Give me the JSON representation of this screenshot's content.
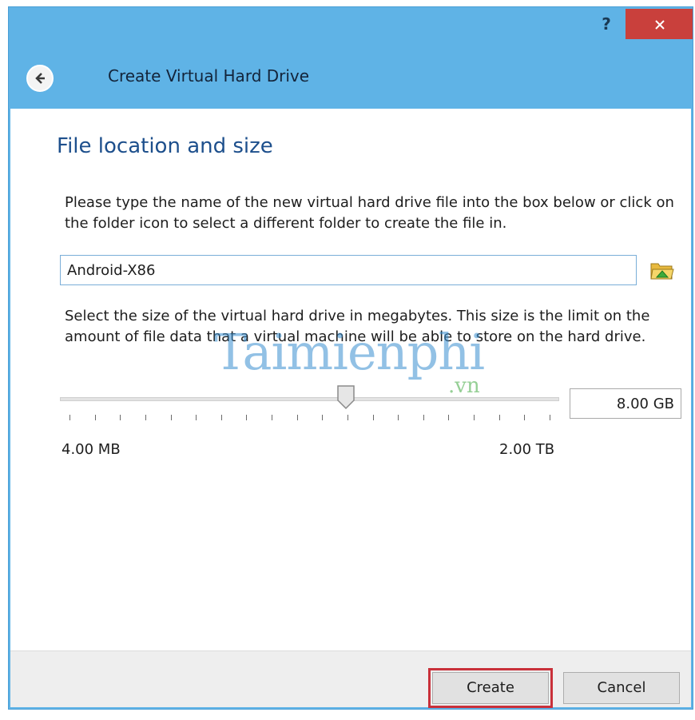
{
  "titlebar": {
    "help_label": "?"
  },
  "header": {
    "title": "Create Virtual Hard Drive"
  },
  "main": {
    "section_title": "File location and size",
    "instructions_location": "Please type the name of the new virtual hard drive file into the box below or click on the folder icon to select a different folder to create the file in.",
    "file_name_value": "Android-X86",
    "instructions_size": "Select the size of the virtual hard drive in megabytes. This size is the limit on the amount of file data that a virtual machine will be able to store on the hard drive.",
    "size_value": "8.00 GB",
    "slider_min_label": "4.00 MB",
    "slider_max_label": "2.00 TB",
    "slider_position_fraction": 0.575,
    "tick_count": 20
  },
  "watermark": {
    "main": "Taimienphi",
    "sub": ".vn"
  },
  "footer": {
    "create_label": "Create",
    "cancel_label": "Cancel"
  },
  "colors": {
    "titlebar_bg": "#5fb3e6",
    "close_bg": "#c9403c",
    "section_title": "#1d4f8c",
    "highlight": "#c9303a"
  },
  "icons": {
    "help": "question-mark",
    "close": "close-icon",
    "back": "back-arrow-icon",
    "folder": "folder-icon",
    "slider_thumb": "slider-thumb"
  }
}
